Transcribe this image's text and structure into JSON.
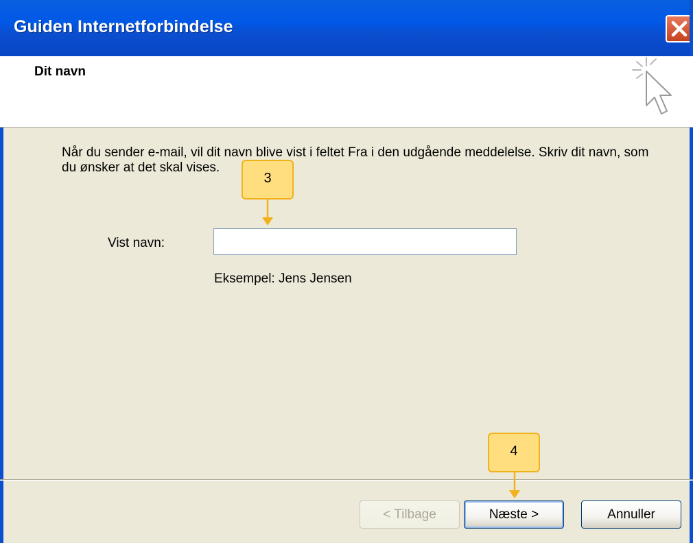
{
  "window": {
    "title": "Guiden Internetforbindelse",
    "close_icon": "close-icon"
  },
  "header": {
    "title": "Dit navn",
    "icon": "wizard-cursor-icon"
  },
  "content": {
    "description": "Når du sender e-mail, vil dit navn blive vist i feltet Fra i den udgående meddelelse. Skriv dit navn, som du ønsker at det skal vises.",
    "field_label": "Vist navn:",
    "field_value": "",
    "example": "Eksempel: Jens Jensen"
  },
  "buttons": {
    "back": "< Tilbage",
    "next": "Næste >",
    "cancel": "Annuller"
  },
  "callouts": [
    {
      "label": "3",
      "target": "display-name-input"
    },
    {
      "label": "4",
      "target": "next-button"
    }
  ],
  "colors": {
    "titlebar": "#0A5FE0",
    "dialog_bg": "#ECE9D8",
    "callout_fill": "#FFDE7F",
    "callout_border": "#F2B21D"
  }
}
